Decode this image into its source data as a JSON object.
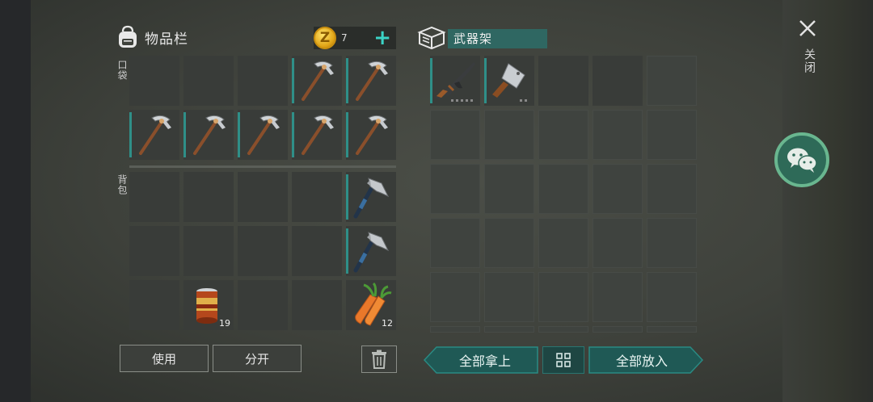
{
  "inventory": {
    "title": "物品栏",
    "icon": "backpack-icon",
    "coins": {
      "count": "7",
      "symbol": "Z",
      "add_label": "+"
    },
    "pocket_label": "口袋",
    "backpack_label": "背包",
    "pocket": [
      {
        "item": ""
      },
      {
        "item": ""
      },
      {
        "item": ""
      },
      {
        "item": "pickaxe"
      },
      {
        "item": "pickaxe"
      },
      {
        "item": "pickaxe"
      },
      {
        "item": "pickaxe"
      },
      {
        "item": "pickaxe"
      },
      {
        "item": "pickaxe"
      },
      {
        "item": ""
      }
    ],
    "backpack": [
      {
        "item": ""
      },
      {
        "item": ""
      },
      {
        "item": ""
      },
      {
        "item": ""
      },
      {
        "item": "hatchet"
      },
      {
        "item": ""
      },
      {
        "item": ""
      },
      {
        "item": ""
      },
      {
        "item": ""
      },
      {
        "item": "hatchet"
      },
      {
        "item": ""
      },
      {
        "item": "canned-food",
        "qty": "19"
      },
      {
        "item": ""
      },
      {
        "item": ""
      },
      {
        "item": "carrots",
        "qty": "12"
      }
    ],
    "use_label": "使用",
    "split_label": "分开"
  },
  "weapon_rack": {
    "title": "武器架",
    "icon": "crate-icon",
    "take_all_label": "全部拿上",
    "put_all_label": "全部放入",
    "slots_filled": [
      "assault-rifle",
      "cleaver"
    ]
  },
  "close_label": "关闭",
  "colors": {
    "accent": "#2f8f88",
    "teal_button": "#1f5955",
    "coin": "#e0a416"
  }
}
